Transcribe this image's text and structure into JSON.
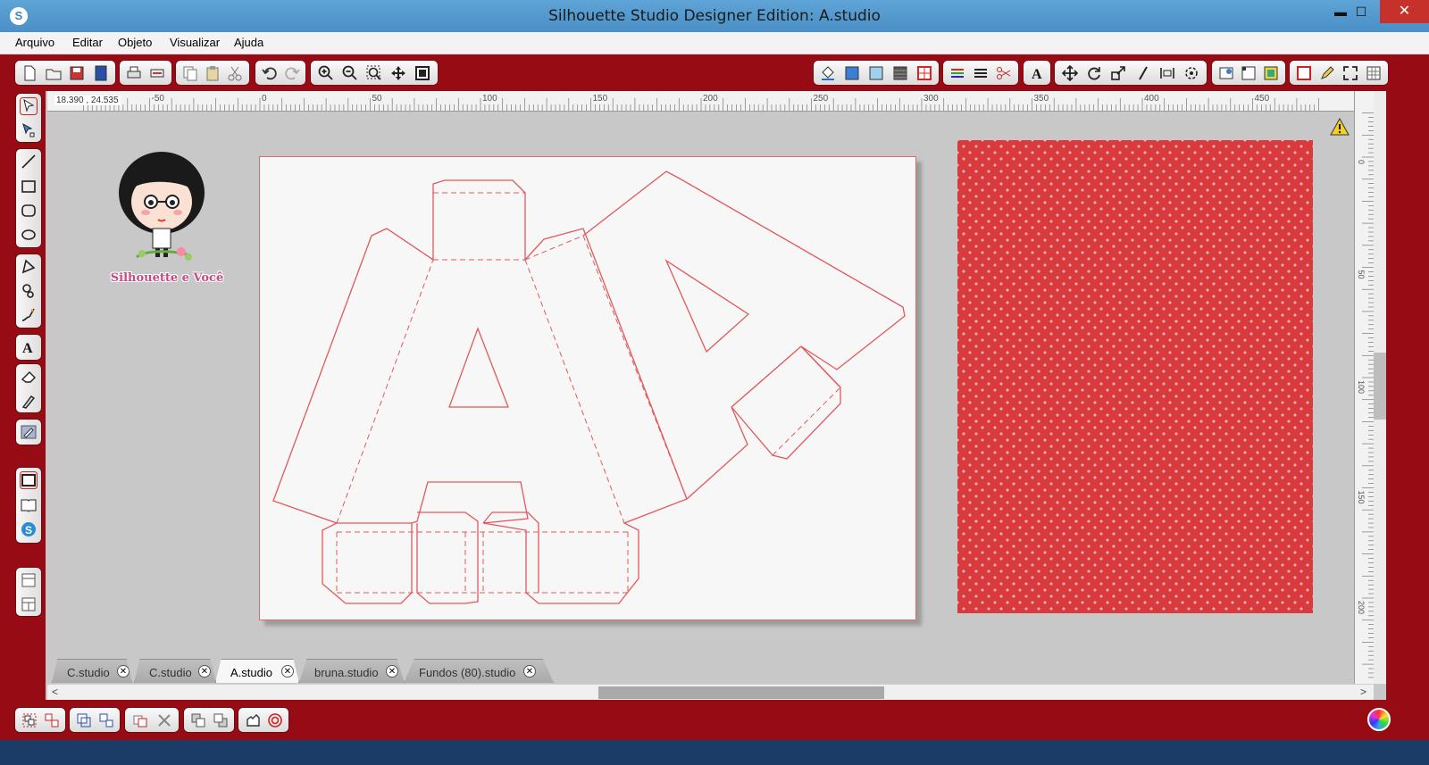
{
  "window": {
    "title": "Silhouette Studio Designer Edition: A.studio",
    "controls": {
      "minimize": "▬",
      "maximize": "☐",
      "close": "✕"
    }
  },
  "menu": [
    "Arquivo",
    "Editar",
    "Objeto",
    "Visualizar",
    "Ajuda"
  ],
  "ruler": {
    "coordinates": "18.390 , 24.535",
    "h_ticks": [
      "-50",
      "0",
      "50",
      "100",
      "150",
      "200",
      "250",
      "300",
      "350",
      "400",
      "450"
    ],
    "v_ticks": [
      "0",
      "50",
      "100",
      "150",
      "200"
    ]
  },
  "logo": {
    "text": "Silhouette e Você"
  },
  "tabs": [
    {
      "label": "C.studio",
      "active": false
    },
    {
      "label": "C.studio",
      "active": false
    },
    {
      "label": "A.studio",
      "active": true
    },
    {
      "label": "bruna.studio",
      "active": false
    },
    {
      "label": "Fundos (80).studio",
      "active": false
    }
  ],
  "tab_close_glyph": "✕",
  "scroll_arrows": {
    "left": "<",
    "right": ">"
  },
  "colors": {
    "accent": "#970b15",
    "titlebar": "#4a8fc6",
    "cut_line": "#e2585c",
    "pattern": "#d83a3e"
  }
}
